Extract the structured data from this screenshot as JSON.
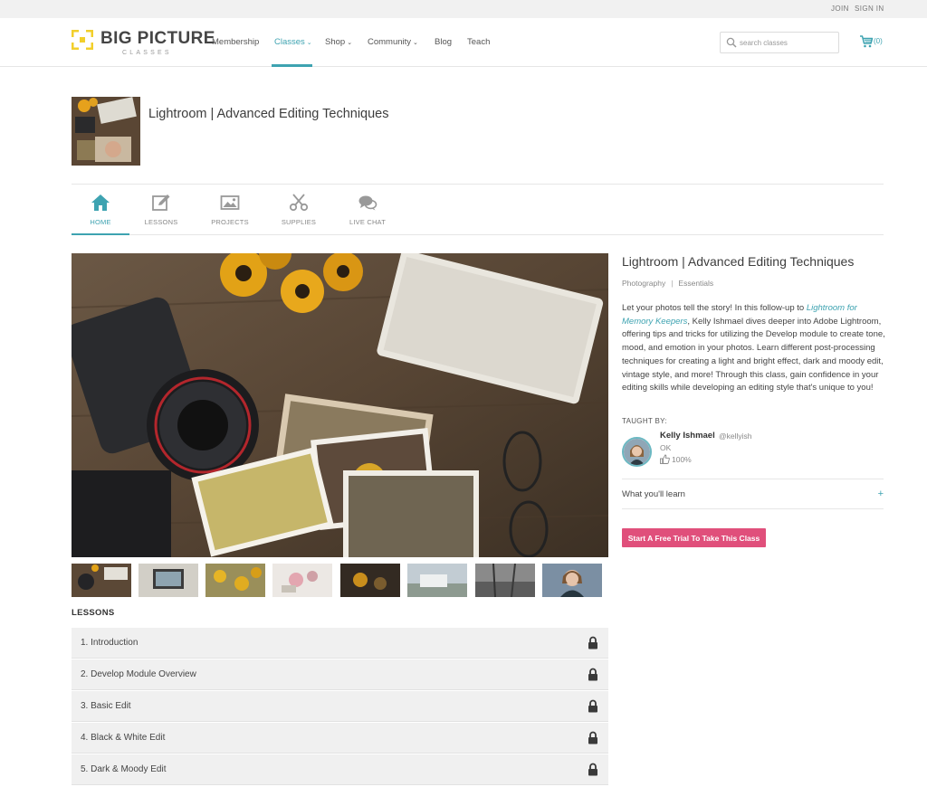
{
  "utility": {
    "join": "JOIN",
    "signin": "SIGN IN"
  },
  "logo": {
    "word": "BIG PICTURE",
    "sub": "CLASSES"
  },
  "nav": {
    "membership": "Membership",
    "classes": "Classes",
    "shop": "Shop",
    "community": "Community",
    "blog": "Blog",
    "teach": "Teach",
    "chevron": "⌄"
  },
  "search": {
    "placeholder": "search classes",
    "icon": "search-icon"
  },
  "cart": {
    "count": "(0)",
    "icon": "cart-icon"
  },
  "class_header": {
    "title": "Lightroom | Advanced Editing Techniques"
  },
  "tabs": [
    {
      "label": "HOME",
      "icon": "home-icon",
      "active": true
    },
    {
      "label": "LESSONS",
      "icon": "edit-icon",
      "active": false
    },
    {
      "label": "PROJECTS",
      "icon": "image-icon",
      "active": false
    },
    {
      "label": "SUPPLIES",
      "icon": "scissors-icon",
      "active": false
    },
    {
      "label": "LIVE CHAT",
      "icon": "chat-icon",
      "active": false
    }
  ],
  "lessons": {
    "heading": "LESSONS",
    "items": [
      {
        "label": "1. Introduction",
        "locked": true
      },
      {
        "label": "2. Develop Module Overview",
        "locked": true
      },
      {
        "label": "3. Basic Edit",
        "locked": true
      },
      {
        "label": "4. Black & White Edit",
        "locked": true
      },
      {
        "label": "5. Dark & Moody Edit",
        "locked": true
      }
    ]
  },
  "sidebar": {
    "title": "Lightroom | Advanced Editing Techniques",
    "tags": [
      "Photography",
      "Essentials"
    ],
    "tag_separator": "|",
    "description_pre": "Let your photos tell the story! In this follow-up to ",
    "description_link": "Lightroom for Memory Keepers",
    "description_post": ", Kelly Ishmael dives deeper into Adobe Lightroom, offering tips and tricks for utilizing the Develop module to create tone, mood, and emotion in your photos. Learn different post-processing techniques for creating a light and bright effect, dark and moody edit, vintage style, and more! Through this class, gain confidence in your editing skills while developing an editing style that's unique to you!",
    "taught_by": "TAUGHT BY:",
    "instructor": {
      "name": "Kelly Ishmael",
      "handle": "@kellyish",
      "location": "OK",
      "rating": "100%"
    },
    "learn_label": "What you'll learn",
    "learn_toggle": "+",
    "cta": "Start A Free Trial To Take This Class"
  },
  "colors": {
    "accent": "#3ea3b1",
    "cta": "#e04f7b",
    "logo_yellow": "#f2cf2b"
  }
}
